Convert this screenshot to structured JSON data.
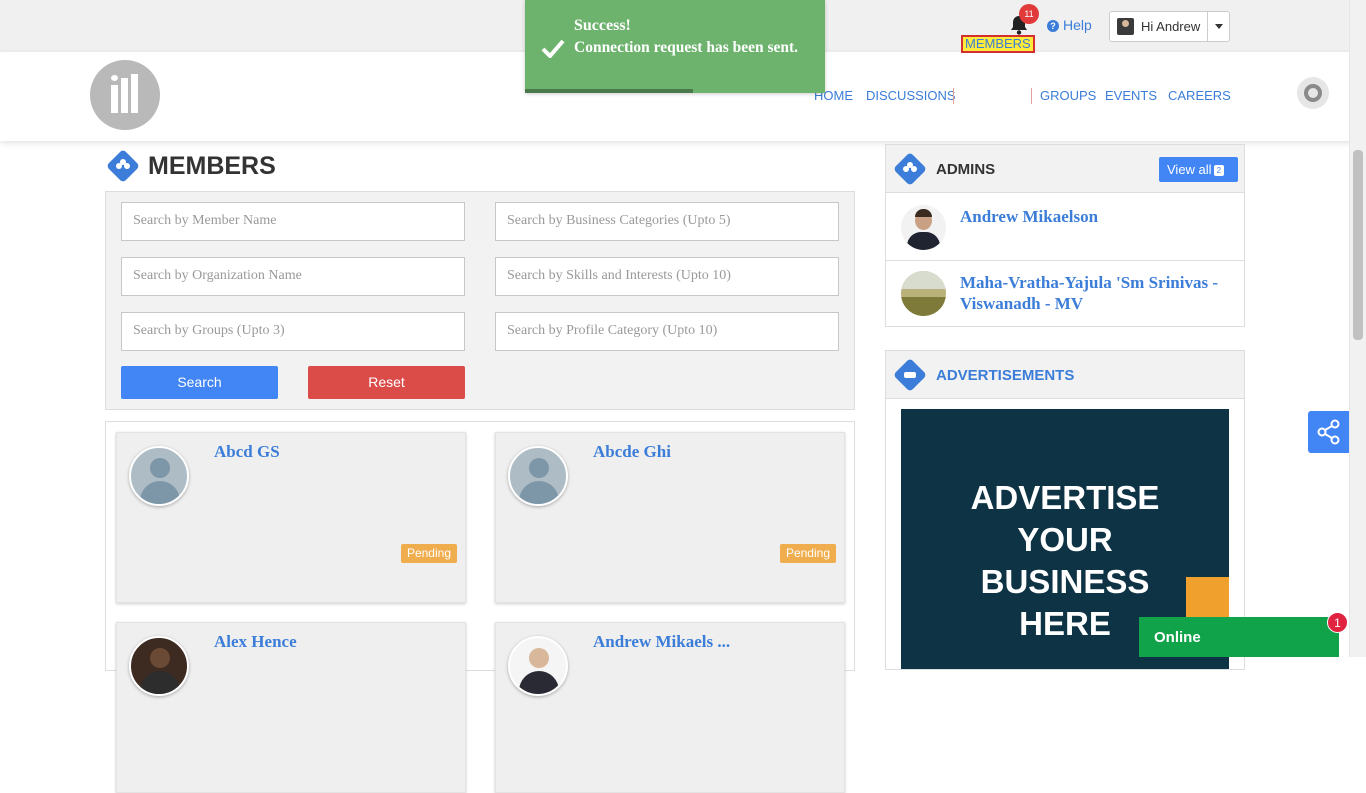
{
  "topbar": {
    "notification_count": "11",
    "help_label": "Help",
    "user_greeting": "Hi Andrew"
  },
  "toast": {
    "title": "Success!",
    "message": "Connection request has been sent.",
    "progress": 0.56
  },
  "nav": {
    "items": [
      "HOME",
      "DISCUSSIONS",
      "MEMBERS",
      "GROUPS",
      "EVENTS",
      "CAREERS"
    ],
    "active": "MEMBERS"
  },
  "members": {
    "title": "MEMBERS",
    "search": {
      "member_name": "Search by Member Name",
      "organization": "Search by Organization Name",
      "groups": "Search by Groups (Upto 3)",
      "business_categories": "Search by Business Categories (Upto 5)",
      "skills": "Search by Skills and Interests (Upto 10)",
      "profile_category": "Search by Profile Category (Upto 10)",
      "search_button": "Search",
      "reset_button": "Reset"
    },
    "cards": [
      {
        "name": "Abcd GS",
        "status": "Pending"
      },
      {
        "name": "Abcde Ghi",
        "status": "Pending"
      },
      {
        "name": "Alex Hence"
      },
      {
        "name": "Andrew Mikaels ..."
      }
    ]
  },
  "admins": {
    "title": "ADMINS",
    "view_all": "View all",
    "count": "2",
    "list": [
      {
        "name": "Andrew Mikaelson"
      },
      {
        "name": "Maha-Vratha-Yajula 'Sm Srinivas - Viswanadh - MV"
      }
    ]
  },
  "ads": {
    "title": "ADVERTISEMENTS",
    "lines": [
      "ADVERTISE",
      "YOUR",
      "BUSINESS",
      "HERE"
    ]
  },
  "chat": {
    "status": "Online",
    "badge": "1"
  },
  "colors": {
    "accent": "#3b7dd8",
    "success": "#6db36e",
    "danger": "#db4c49",
    "pending": "#f0ad4e",
    "online": "#10a349"
  }
}
